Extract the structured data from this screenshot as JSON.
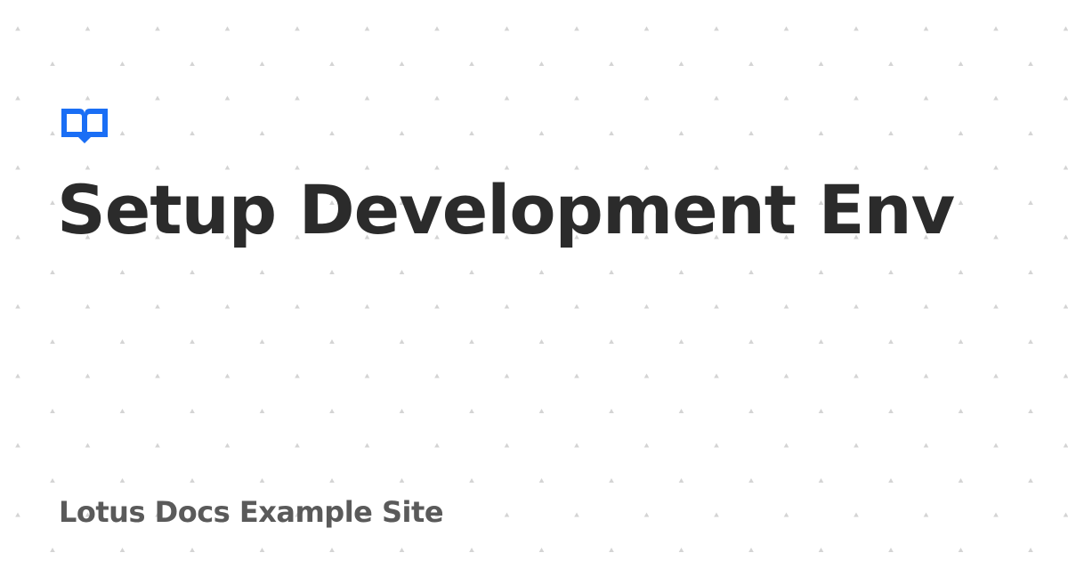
{
  "card": {
    "title": "Setup Development Env",
    "site_name": "Lotus Docs Example Site",
    "logo_icon": "book-open-icon",
    "background_pattern": "dot-grid-pattern"
  },
  "colors": {
    "background": "#ffffff",
    "title": "#2b2b2b",
    "site_name": "#5a5a5a",
    "accent": "#1a6ef5",
    "pattern_dot": "#d4d4d4"
  }
}
